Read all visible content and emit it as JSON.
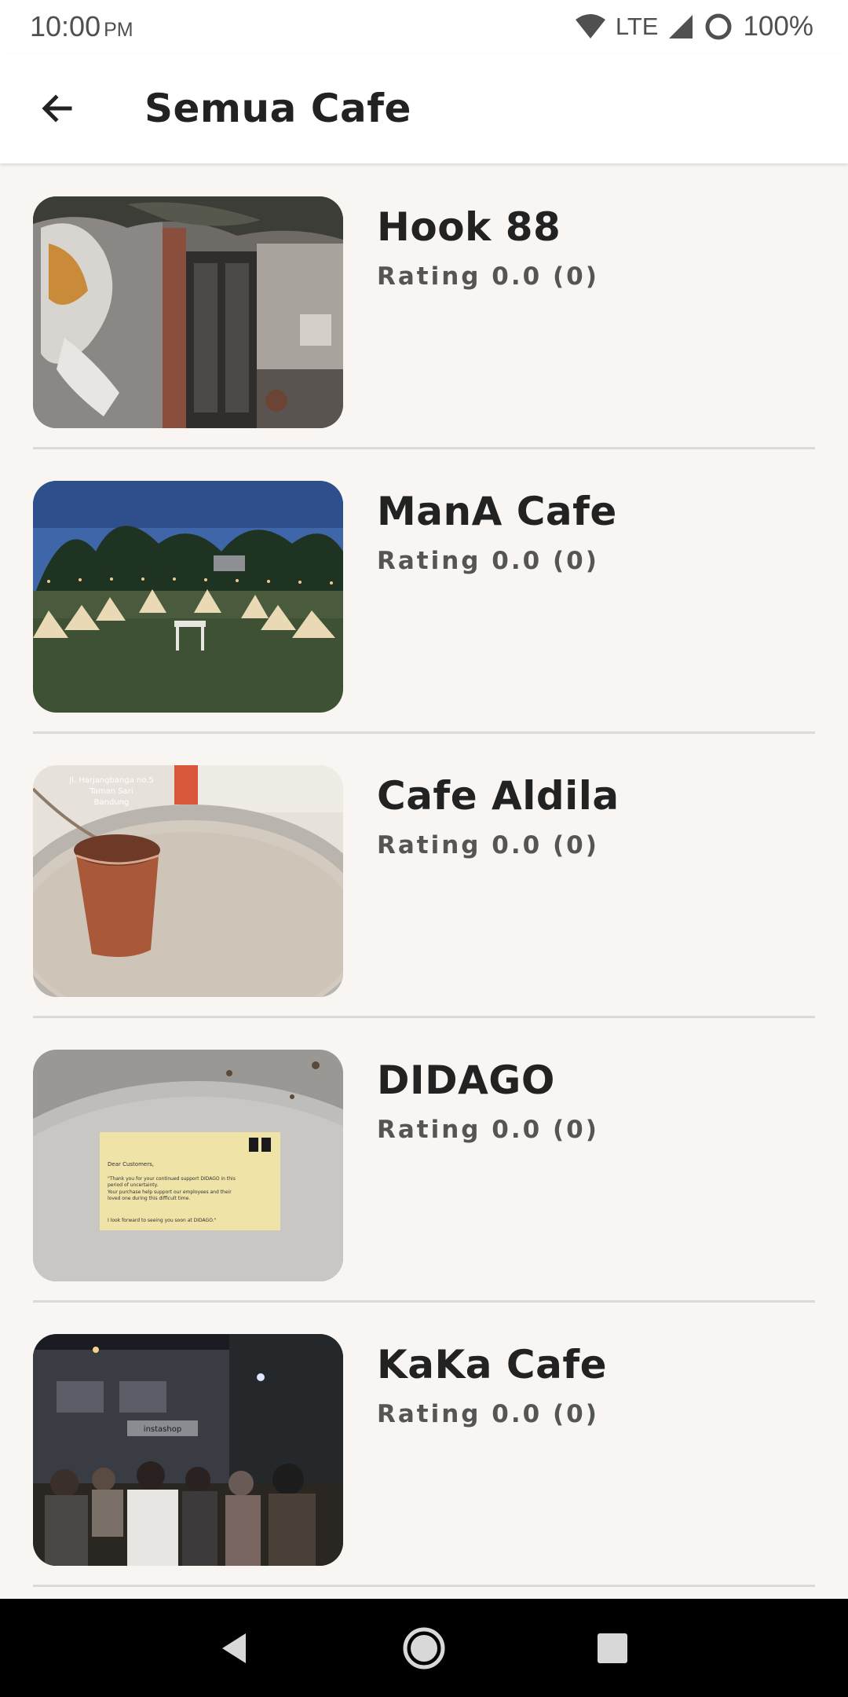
{
  "status_bar": {
    "time": "10:00",
    "ampm": "PM",
    "network": "LTE",
    "battery": "100%"
  },
  "header": {
    "title": "Semua Cafe",
    "back_icon": "arrow-left-icon"
  },
  "cafes": [
    {
      "name": "Hook 88",
      "rating": "Rating 0.0 (0)"
    },
    {
      "name": "ManA Cafe",
      "rating": "Rating 0.0 (0)"
    },
    {
      "name": "Cafe Aldila",
      "rating": "Rating 0.0 (0)"
    },
    {
      "name": "DIDAGO",
      "rating": "Rating 0.0 (0)"
    },
    {
      "name": "KaKa Cafe",
      "rating": "Rating 0.0 (0)"
    }
  ],
  "photo_text": {
    "aldila_address_1": "Jl. Harjangbanga no.5",
    "aldila_address_2": "Taman Sari",
    "aldila_address_3": "Bandung",
    "didago_card_heading": "Dear Customers,",
    "didago_card_line1": "\"Thank you for your continued support DIDAGO in this",
    "didago_card_line2": "period of uncertainty.",
    "didago_card_line3": "Your purchase help support our employees and their",
    "didago_card_line4": "loved one during this difficult time.",
    "didago_card_line5": "I look forward to seeing you soon at DIDAGO.\"",
    "kaka_sign": "instashop"
  },
  "nav_bar": {
    "back": "nav-back-icon",
    "home": "nav-home-icon",
    "recents": "nav-recents-icon"
  },
  "colors": {
    "background": "#f8f5f2",
    "app_bar": "#ffffff",
    "divider": "#dcd9d6",
    "nav_bar": "#000000"
  }
}
